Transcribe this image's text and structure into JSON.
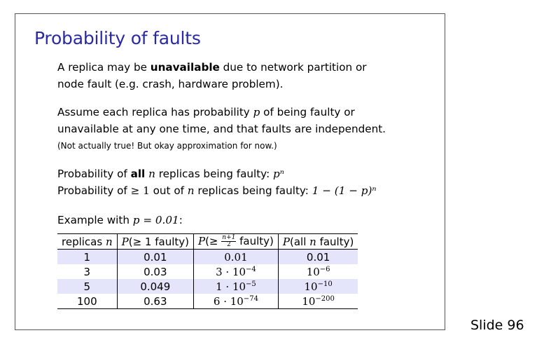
{
  "slide": {
    "title": "Probability of faults",
    "number_label": "Slide 96"
  },
  "text": {
    "p1_a": "A replica may be ",
    "p1_bold": "unavailable",
    "p1_b": " due to network partition or",
    "p1_line2": "node fault (e.g. crash, hardware problem).",
    "p2_a": "Assume each replica has probability ",
    "p2_var": "p",
    "p2_b": " of being faulty or",
    "p2_line2": "unavailable at any one time, and that faults are independent.",
    "p2_note": "(Not actually true! But okay approximation for now.)",
    "p3_a": "Probability of ",
    "p3_bold": "all",
    "p3_b": " replicas being faulty: ",
    "p3_formula": "pⁿ",
    "p4_a": "Probability of ",
    "p4_ge": "≥ 1",
    "p4_b": " out of ",
    "p4_c": " replicas being faulty: ",
    "p4_formula": "1 − (1 − p)ⁿ",
    "n_var": "n",
    "example_a": "Example with ",
    "example_formula": "p = 0.01",
    "example_b": ":"
  },
  "table": {
    "headers": {
      "col1_text": "replicas ",
      "col1_var": "n",
      "col2_p": "P",
      "col2_rest": "(≥ 1 faulty)",
      "col3_p": "P",
      "col3_open": "(≥ ",
      "col3_frac_num": "n+1",
      "col3_frac_den": "2",
      "col3_close": " faulty)",
      "col4_p": "P",
      "col4_open": "(all ",
      "col4_var": "n",
      "col4_close": " faulty)"
    },
    "rows": [
      {
        "replicas": "1",
        "ge1": "0.01",
        "majority_base": "0.01",
        "majority_exp": "",
        "all_base": "0.01",
        "all_exp": ""
      },
      {
        "replicas": "3",
        "ge1": "0.03",
        "majority_base": "3 · 10",
        "majority_exp": "−4",
        "all_base": "10",
        "all_exp": "−6"
      },
      {
        "replicas": "5",
        "ge1": "0.049",
        "majority_base": "1 · 10",
        "majority_exp": "−5",
        "all_base": "10",
        "all_exp": "−10"
      },
      {
        "replicas": "100",
        "ge1": "0.63",
        "majority_base": "6 · 10",
        "majority_exp": "−74",
        "all_base": "10",
        "all_exp": "−200"
      }
    ]
  },
  "colors": {
    "title": "#2a2aa6",
    "row_highlight": "#e4e4fa"
  }
}
